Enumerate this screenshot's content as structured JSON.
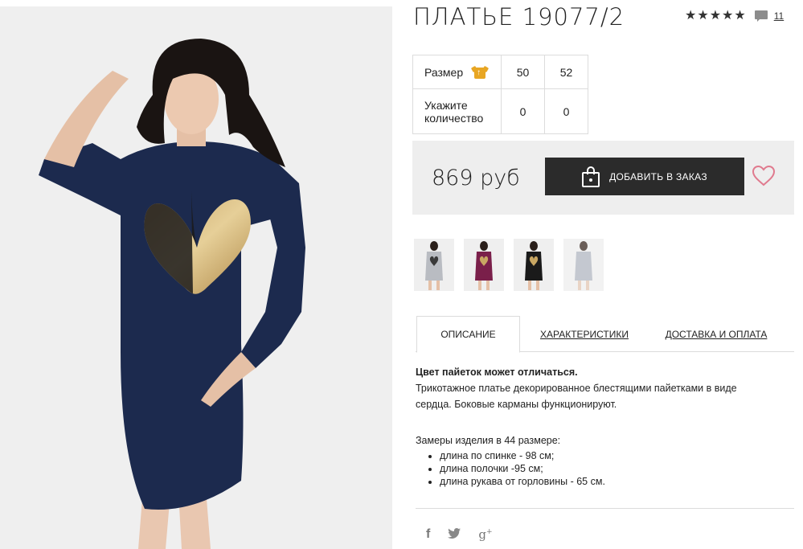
{
  "product": {
    "title": "ПЛАТЬЕ 19077/2",
    "stars": "★★★★★",
    "review_count": "11",
    "photo_icon": "product-photo"
  },
  "size_table": {
    "size_label": "Размер",
    "sizes": [
      "50",
      "52"
    ],
    "qty_label_line1": "Укажите",
    "qty_label_line2": "количество",
    "quantities": [
      "0",
      "0"
    ]
  },
  "purchase": {
    "price": "869 руб",
    "order_button": "ДОБАВИТЬ В ЗАКАЗ",
    "bag_icon": "shopping-bag-icon",
    "wishlist_icon": "heart-icon"
  },
  "thumbnails": [
    {
      "name": "grey-dress"
    },
    {
      "name": "burgundy-dress"
    },
    {
      "name": "black-dress"
    },
    {
      "name": "light-grey-dress"
    }
  ],
  "tabs": {
    "description": "ОПИСАНИЕ",
    "characteristics": "ХАРАКТЕРИСТИКИ",
    "delivery": "ДОСТАВКА И ОПЛАТА"
  },
  "description": {
    "note": "Цвет пайеток может отличаться.",
    "text": "Трикотажное платье декорированное блестящими пайетками в виде сердца. Боковые карманы функционируют.",
    "measure_title": "Замеры изделия в 44 размере:",
    "measures": [
      "длина по спинке - 98 см;",
      "длина полочки -95 см;",
      "длина рукава от горловины - 65 см."
    ]
  },
  "social": {
    "facebook": "f",
    "twitter": "🐦",
    "google_plus": "g"
  },
  "colors": {
    "accent_dark": "#2b2b2b",
    "heart_pink": "#e07a8e",
    "size_icon": "#e8a623",
    "dress_navy": "#1c2a4e"
  }
}
